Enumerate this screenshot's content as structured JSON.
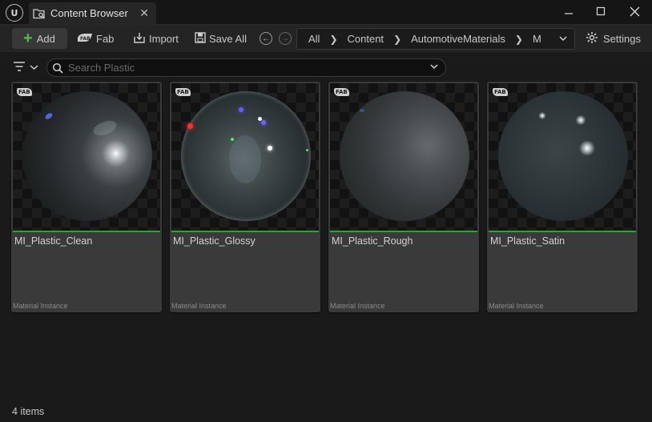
{
  "window": {
    "tab_label": "Content Browser",
    "logo_text": "U"
  },
  "toolbar": {
    "add_label": "Add",
    "fab_label": "Fab",
    "import_label": "Import",
    "save_all_label": "Save All",
    "settings_label": "Settings"
  },
  "breadcrumb": {
    "items": [
      "All",
      "Content",
      "AutomotiveMaterials",
      "M"
    ]
  },
  "search": {
    "placeholder": "Search Plastic"
  },
  "assets": [
    {
      "name": "MI_Plastic_Clean",
      "type": "Material Instance",
      "badge": "FAB"
    },
    {
      "name": "MI_Plastic_Glossy",
      "type": "Material Instance",
      "badge": "FAB"
    },
    {
      "name": "MI_Plastic_Rough",
      "type": "Material Instance",
      "badge": "FAB"
    },
    {
      "name": "MI_Plastic_Satin",
      "type": "Material Instance",
      "badge": "FAB"
    }
  ],
  "status": {
    "item_count": "4 items"
  },
  "colors": {
    "accent_green": "#1fae2c",
    "add_plus": "#4cc044",
    "background": "#1a1a1a",
    "tile": "#3a3a3a"
  },
  "icons": [
    "unreal-logo-icon",
    "folder-search-icon",
    "close-icon",
    "minimize-icon",
    "maximize-icon",
    "plus-icon",
    "fab-icon",
    "import-icon",
    "save-icon",
    "back-icon",
    "forward-icon",
    "chevron-right-icon",
    "chevron-down-icon",
    "gear-icon",
    "filter-icon",
    "search-icon"
  ]
}
